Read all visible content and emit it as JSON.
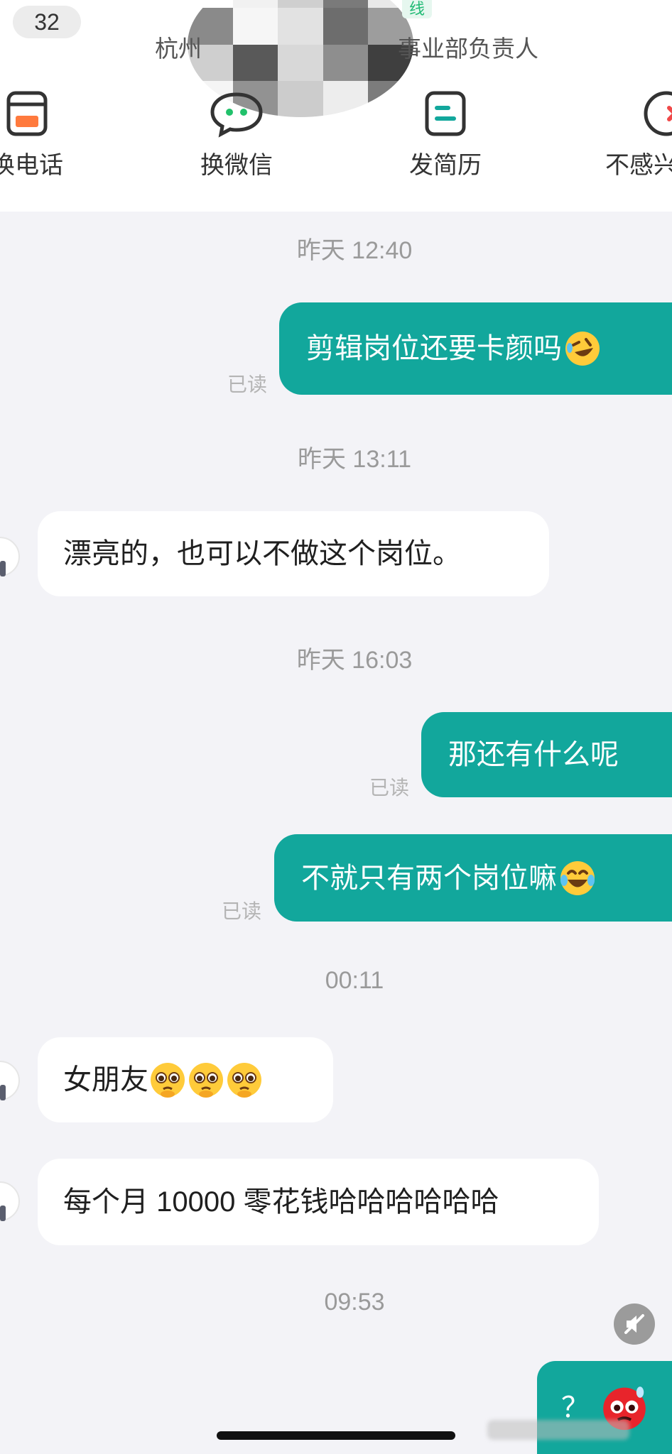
{
  "header": {
    "unread_count": "32",
    "online_tag": "线",
    "company_partial": "杭州",
    "role_partial": "事业部负责人"
  },
  "actions": [
    {
      "label": "换电话",
      "icon": "phone-swap-icon"
    },
    {
      "label": "换微信",
      "icon": "wechat-icon"
    },
    {
      "label": "发简历",
      "icon": "resume-icon"
    },
    {
      "label": "不感兴",
      "icon": "not-interested-icon"
    }
  ],
  "messages": {
    "ts1": "昨天 12:40",
    "m1": "剪辑岗位还要卡颜吗",
    "m1_read": "已读",
    "ts2": "昨天 13:11",
    "m2": "漂亮的，也可以不做这个岗位。",
    "ts3": "昨天 16:03",
    "m3": "那还有什么呢",
    "m3_read": "已读",
    "m4": "不就只有两个岗位嘛",
    "m4_read": "已读",
    "ts4": "00:11",
    "m5": "女朋友",
    "m6": "每个月 10000 零花钱哈哈哈哈哈哈",
    "ts5": "09:53",
    "m7": "？"
  },
  "colors": {
    "outgoing_bubble": "#12a79c",
    "incoming_bubble": "#ffffff",
    "background": "#f3f3f7"
  },
  "icons": {
    "rofl": "rolling-on-floor-laughing-emoji",
    "tears_of_joy": "face-with-tears-of-joy-emoji",
    "pleading": "pleading-face-emoji",
    "hot_face": "red-sweating-face-emoji",
    "mute": "mute-speaker-icon"
  }
}
